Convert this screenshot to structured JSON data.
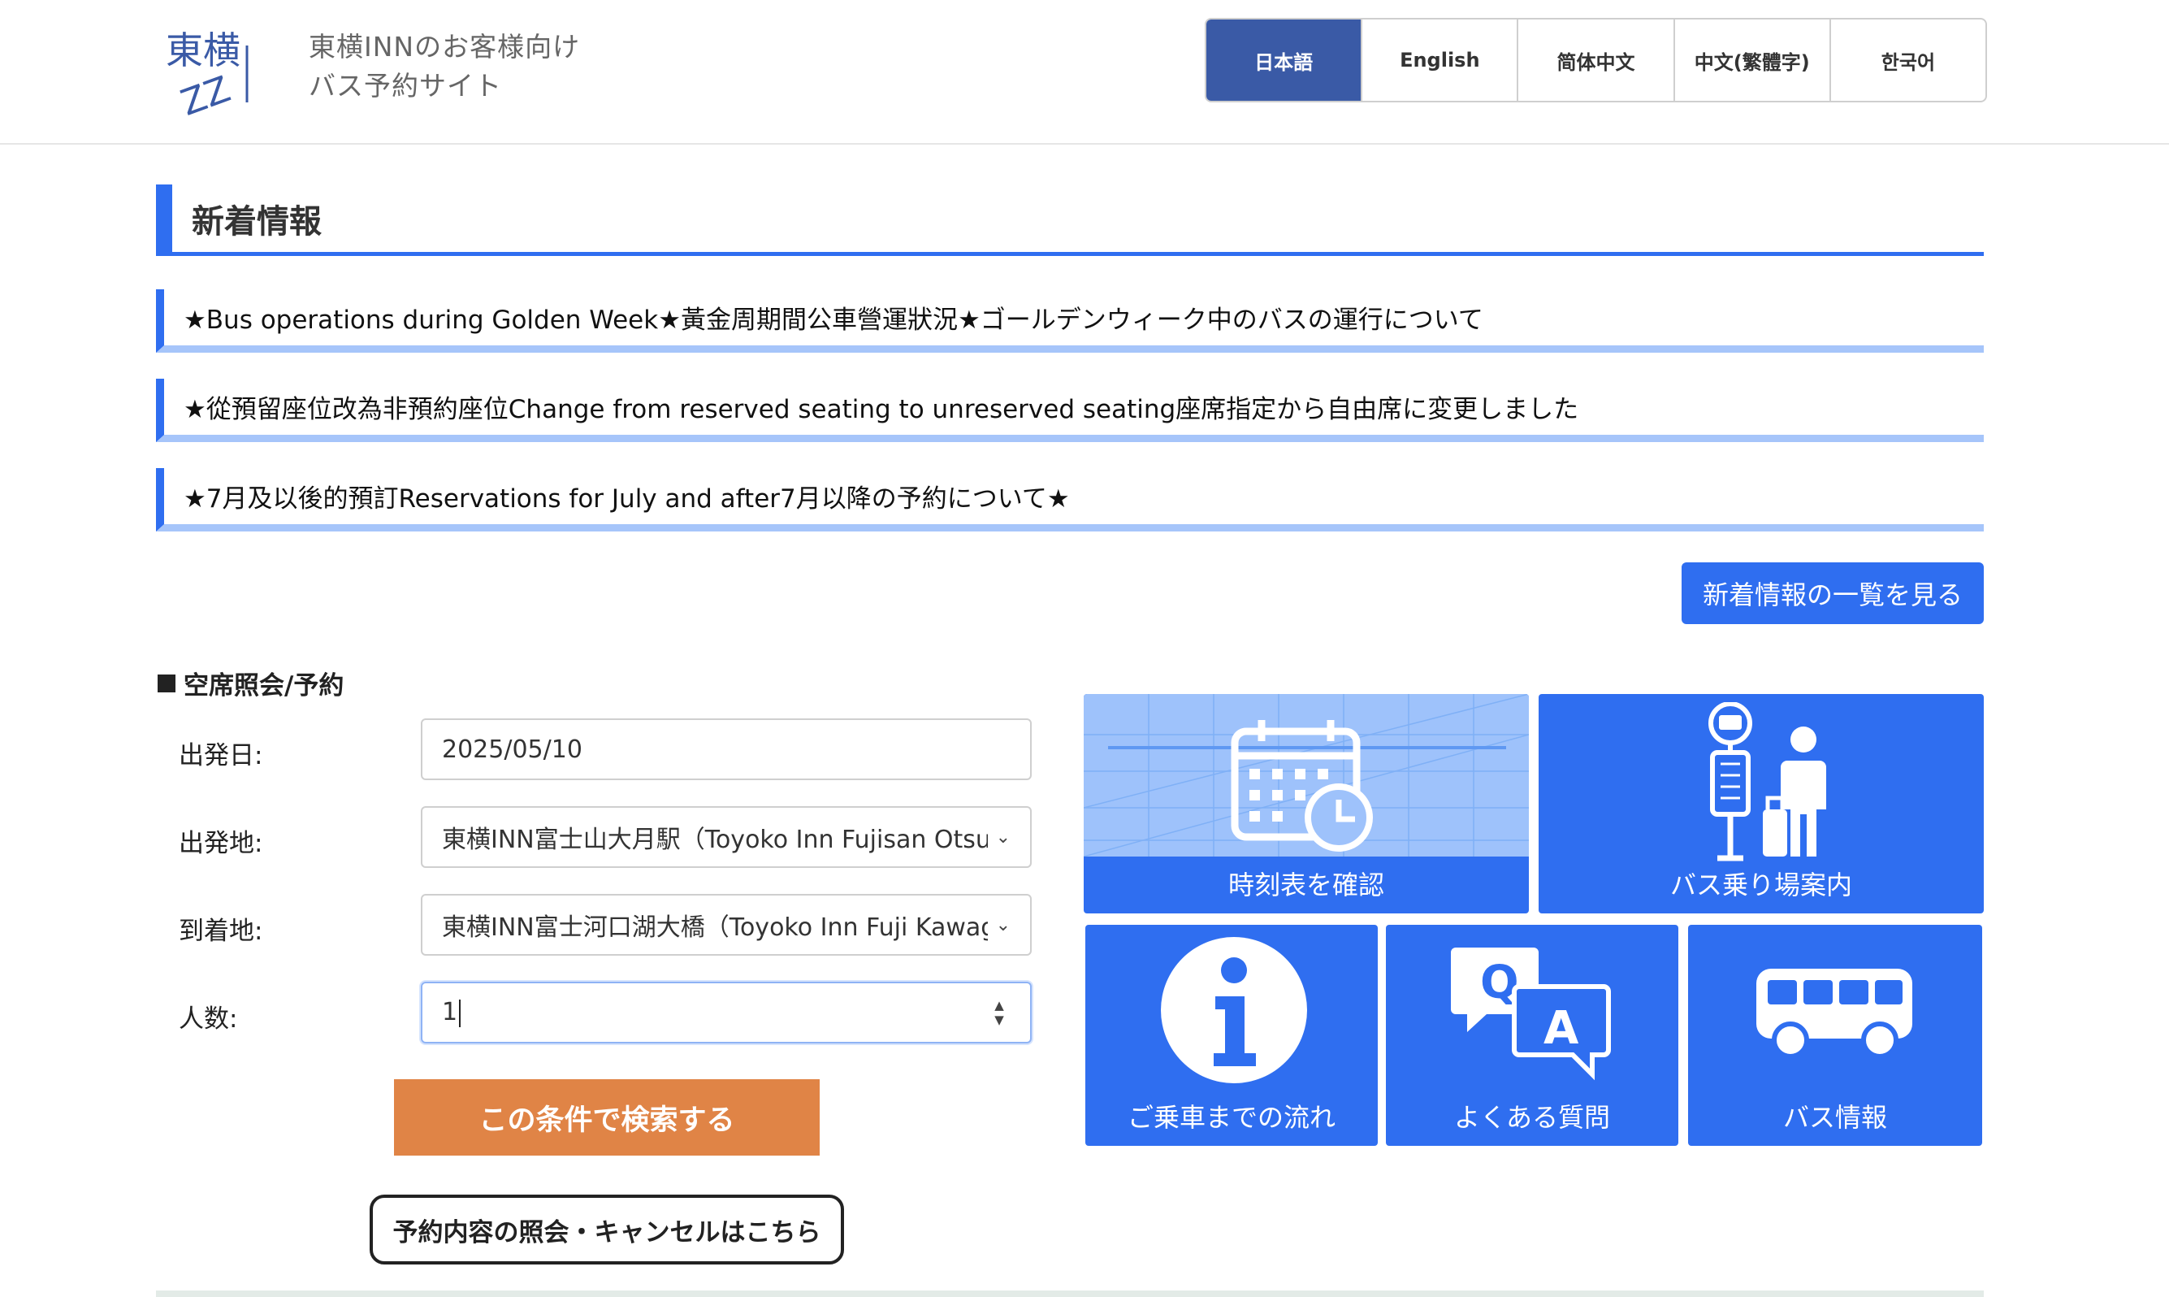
{
  "header": {
    "logo_text": "東横INN",
    "site_title_line1": "東横INNのお客様向け",
    "site_title_line2": "バス予約サイト",
    "languages": [
      {
        "label": "日本語",
        "active": true
      },
      {
        "label": "English",
        "active": false
      },
      {
        "label": "简体中文",
        "active": false
      },
      {
        "label": "中文(繁體字)",
        "active": false
      },
      {
        "label": "한국어",
        "active": false
      }
    ]
  },
  "news": {
    "heading": "新着情報",
    "items": [
      "★Bus operations during Golden Week★黃金周期間公車營運狀況★ゴールデンウィーク中のバスの運行について",
      "★從預留座位改為非預約座位Change from reserved seating to unreserved seating座席指定から自由席に変更しました",
      "★7月及以後的預訂Reservations for July and after7月以降の予約について★"
    ],
    "list_button": "新着情報の一覧を見る"
  },
  "search": {
    "heading": "空席照会/予約",
    "date_label": "出発日:",
    "date_value": "2025/05/10",
    "origin_label": "出発地:",
    "origin_value": "東横INN富士山大月駅（Toyoko Inn Fujisan Otsuki-",
    "destination_label": "到着地:",
    "destination_value": "東横INN富士河口湖大橋（Toyoko Inn Fuji Kawaguc",
    "passengers_label": "人数:",
    "passengers_value": "1",
    "search_button": "この条件で検索する",
    "cancel_button": "予約内容の照会・キャンセルはこちら"
  },
  "tiles": {
    "timetable": {
      "label": "時刻表を確認",
      "icon": "calendar-clock-icon"
    },
    "bus_stop": {
      "label": "バス乗り場案内",
      "icon": "bus-stop-icon"
    },
    "flow": {
      "label": "ご乗車までの流れ",
      "icon": "info-icon"
    },
    "faq": {
      "label": "よくある質問",
      "icon": "qa-icon"
    },
    "bus_info": {
      "label": "バス情報",
      "icon": "bus-icon"
    }
  },
  "colors": {
    "primary": "#2f6ef0",
    "lang_active": "#3a5aa6",
    "search_button": "#e08446",
    "news_underline": "#a6c5fa"
  }
}
